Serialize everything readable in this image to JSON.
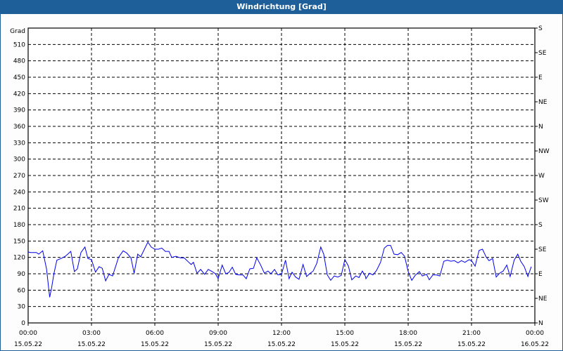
{
  "title": "Windrichtung [Grad]",
  "chart_data": {
    "type": "line",
    "title": "Windrichtung [Grad]",
    "ylabel": "Grad",
    "xlabel": "",
    "ylim": [
      0,
      540
    ],
    "xlim_hours": [
      0,
      24
    ],
    "grid": true,
    "y_ticks": [
      0,
      30,
      60,
      90,
      120,
      150,
      180,
      210,
      240,
      270,
      300,
      330,
      360,
      390,
      420,
      450,
      480,
      510
    ],
    "right_ticks": [
      {
        "value": 0,
        "label": "N"
      },
      {
        "value": 45,
        "label": "NE"
      },
      {
        "value": 90,
        "label": "E"
      },
      {
        "value": 135,
        "label": "SE"
      },
      {
        "value": 180,
        "label": "S"
      },
      {
        "value": 225,
        "label": "SW"
      },
      {
        "value": 270,
        "label": "W"
      },
      {
        "value": 315,
        "label": "NW"
      },
      {
        "value": 360,
        "label": "N"
      },
      {
        "value": 405,
        "label": "NE"
      },
      {
        "value": 450,
        "label": "E"
      },
      {
        "value": 495,
        "label": "SE"
      },
      {
        "value": 540,
        "label": "S"
      }
    ],
    "x_ticks": [
      {
        "hour": 0,
        "time": "00:00",
        "date": "15.05.22"
      },
      {
        "hour": 3,
        "time": "03:00",
        "date": "15.05.22"
      },
      {
        "hour": 6,
        "time": "06:00",
        "date": "15.05.22"
      },
      {
        "hour": 9,
        "time": "09:00",
        "date": "15.05.22"
      },
      {
        "hour": 12,
        "time": "12:00",
        "date": "15.05.22"
      },
      {
        "hour": 15,
        "time": "15:00",
        "date": "15.05.22"
      },
      {
        "hour": 18,
        "time": "18:00",
        "date": "15.05.22"
      },
      {
        "hour": 21,
        "time": "21:00",
        "date": "15.05.22"
      },
      {
        "hour": 24,
        "time": "00:00",
        "date": "16.05.22"
      }
    ],
    "series": [
      {
        "name": "Windrichtung",
        "color": "#0000ee",
        "hours": [
          0,
          0.11,
          0.39,
          0.5,
          0.69,
          0.87,
          1.02,
          1.11,
          1.22,
          1.36,
          1.56,
          1.76,
          2.02,
          2.19,
          2.33,
          2.5,
          2.69,
          2.83,
          3.0,
          3.19,
          3.36,
          3.51,
          3.67,
          3.83,
          4.0,
          4.28,
          4.5,
          4.67,
          4.87,
          5.02,
          5.19,
          5.33,
          5.67,
          5.83,
          6.0,
          6.17,
          6.33,
          6.5,
          6.67,
          6.8,
          7.0,
          7.22,
          7.39,
          7.61,
          7.72,
          7.83,
          7.98,
          8.0,
          8.17,
          8.36,
          8.53,
          8.72,
          8.87,
          9.0,
          9.19,
          9.36,
          9.5,
          9.67,
          9.83,
          10.0,
          10.17,
          10.33,
          10.5,
          10.67,
          10.83,
          11.0,
          11.19,
          11.36,
          11.5,
          11.67,
          11.83,
          12.0,
          12.19,
          12.36,
          12.5,
          12.67,
          12.83,
          13.02,
          13.19,
          13.33,
          13.5,
          13.67,
          13.86,
          14.0,
          14.17,
          14.33,
          14.5,
          14.67,
          14.83,
          15.0,
          15.17,
          15.33,
          15.52,
          15.67,
          15.83,
          15.98,
          16.0,
          16.17,
          16.33,
          16.5,
          16.69,
          16.87,
          17.02,
          17.17,
          17.33,
          17.5,
          17.67,
          17.83,
          18.0,
          18.17,
          18.33,
          18.53,
          18.67,
          18.87,
          19.0,
          19.17,
          19.33,
          19.5,
          19.69,
          19.86,
          20.02,
          20.19,
          20.36,
          20.52,
          20.69,
          20.89,
          21.02,
          21.17,
          21.36,
          21.52,
          21.69,
          21.83,
          22.0,
          22.17,
          22.33,
          22.5,
          22.67,
          22.83,
          23.02,
          23.19,
          23.33,
          23.5,
          23.67,
          23.83
        ],
        "values": [
          130,
          129,
          129,
          126,
          132,
          99,
          47,
          64,
          90,
          115,
          118,
          122,
          131,
          94,
          99,
          129,
          139,
          118,
          116,
          93,
          103,
          100,
          77,
          89,
          86,
          120,
          132,
          128,
          119,
          91,
          126,
          121,
          148,
          139,
          135,
          135,
          137,
          131,
          131,
          120,
          122,
          119,
          119,
          111,
          107,
          111,
          93,
          91,
          98,
          89,
          98,
          94,
          90,
          81,
          106,
          90,
          92,
          102,
          89,
          88,
          88,
          81,
          99,
          100,
          119,
          107,
          91,
          95,
          90,
          98,
          88,
          89,
          115,
          81,
          93,
          84,
          80,
          107,
          85,
          90,
          95,
          109,
          139,
          126,
          88,
          78,
          86,
          84,
          87,
          116,
          104,
          79,
          86,
          83,
          95,
          85,
          81,
          91,
          88,
          96,
          111,
          137,
          142,
          142,
          126,
          125,
          129,
          122,
          94,
          78,
          87,
          94,
          86,
          89,
          79,
          88,
          88,
          86,
          113,
          115,
          113,
          114,
          110,
          114,
          111,
          116,
          113,
          104,
          133,
          135,
          121,
          114,
          118,
          84,
          91,
          95,
          106,
          85,
          115,
          126,
          113,
          103,
          85,
          103
        ]
      }
    ]
  }
}
